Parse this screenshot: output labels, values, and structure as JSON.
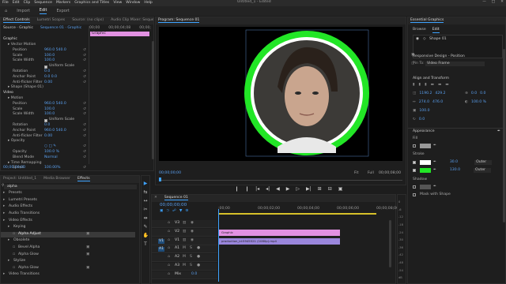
{
  "menubar": {
    "items": [
      "File",
      "Edit",
      "Clip",
      "Sequence",
      "Markers",
      "Graphics and Titles",
      "View",
      "Window",
      "Help"
    ],
    "title": "Untitled_1 - Edited",
    "controls": [
      "—",
      "□",
      "✕"
    ]
  },
  "workspaces": {
    "items": [
      "⌂",
      "Import",
      "Edit",
      "Export"
    ],
    "active": 2
  },
  "effect_controls": {
    "tabs": [
      "Effect Controls",
      "Lumetri Scopes",
      "Source: (no clips)",
      "Audio Clip Mixer: Sequence 01"
    ],
    "source": "Source · Graphic",
    "clip": "Sequence 01 · Graphic",
    "timecodes": [
      "00;00",
      "00;00;04;08",
      "00;00;"
    ],
    "clip_bar": "Graphic",
    "rows": [
      {
        "indent": 0,
        "label": "Graphic"
      },
      {
        "indent": 1,
        "label": "▸ Vector Motion"
      },
      {
        "indent": 2,
        "label": "Position",
        "value": "960.0   540.0"
      },
      {
        "indent": 2,
        "label": "Scale",
        "value": "100.0"
      },
      {
        "indent": 2,
        "label": "Scale Width",
        "value": "100.0"
      },
      {
        "indent": 2,
        "label": "",
        "check": "Uniform Scale"
      },
      {
        "indent": 2,
        "label": "Rotation",
        "value": "0.0"
      },
      {
        "indent": 2,
        "label": "Anchor Point",
        "value": "0.0   0.0"
      },
      {
        "indent": 2,
        "label": "Anti-flicker Filter",
        "value": "0.00"
      },
      {
        "indent": 1,
        "label": "▸ Shape (Shape 01)"
      },
      {
        "indent": 0,
        "label": "Video"
      },
      {
        "indent": 1,
        "label": "▸ Motion"
      },
      {
        "indent": 2,
        "label": "Position",
        "value": "960.0   540.0"
      },
      {
        "indent": 2,
        "label": "Scale",
        "value": "100.0"
      },
      {
        "indent": 2,
        "label": "Scale Width",
        "value": "100.0"
      },
      {
        "indent": 2,
        "label": "",
        "check": "Uniform Scale"
      },
      {
        "indent": 2,
        "label": "Rotation",
        "value": "0.0"
      },
      {
        "indent": 2,
        "label": "Anchor Point",
        "value": "960.0   540.0"
      },
      {
        "indent": 2,
        "label": "Anti-flicker Filter",
        "value": "0.00"
      },
      {
        "indent": 1,
        "label": "▸ Opacity"
      },
      {
        "indent": 2,
        "label": "",
        "value": "○ □ ✎"
      },
      {
        "indent": 2,
        "label": "Opacity",
        "value": "100.0 %"
      },
      {
        "indent": 2,
        "label": "Blend Mode",
        "value": "Normal"
      },
      {
        "indent": 1,
        "label": "▸ Time Remapping"
      },
      {
        "indent": 2,
        "label": "Speed",
        "value": "100.00%"
      }
    ],
    "footer_tc": "00;00;00;00"
  },
  "program": {
    "tab": "Program: Sequence 01",
    "timecode_left": "00;00;00;00",
    "timecode_right": "00;00;08;00",
    "fit": "Fit",
    "quality": "Full"
  },
  "transport": [
    "❙",
    "❙",
    "|◂",
    "◂|",
    "◀",
    "▶",
    "▷",
    "▶|",
    "⊞",
    "⊟",
    "▣"
  ],
  "project": {
    "tabs": [
      "Project: Untitled_1",
      "Media Browser",
      "Effects"
    ],
    "search": "alpha",
    "tree": [
      {
        "indent": 0,
        "label": "Presets"
      },
      {
        "indent": 0,
        "label": "Lumetri Presets"
      },
      {
        "indent": 0,
        "label": "Audio Effects"
      },
      {
        "indent": 0,
        "label": "Audio Transitions"
      },
      {
        "indent": 0,
        "label": "Video Effects"
      },
      {
        "indent": 1,
        "label": "Keying"
      },
      {
        "indent": 2,
        "label": "Alpha Adjust",
        "selected": true
      },
      {
        "indent": 1,
        "label": "Obsolete"
      },
      {
        "indent": 2,
        "label": "Bevel Alpha"
      },
      {
        "indent": 2,
        "label": "Alpha Glow"
      },
      {
        "indent": 1,
        "label": "Stylize"
      },
      {
        "indent": 2,
        "label": "Alpha Glow"
      },
      {
        "indent": 0,
        "label": "Video Transitions"
      }
    ]
  },
  "tools": [
    "▶",
    "⇆",
    "↔",
    "✂",
    "⇹",
    "✎",
    "✋",
    "T"
  ],
  "timeline": {
    "tab": "Sequence 01",
    "timecode": "00;00;00;00",
    "ruler": [
      ":00;00",
      "00;00;02;00",
      "00;00;04;00",
      "00;00;06;00",
      "00;00;08;00"
    ],
    "tracks": [
      {
        "id": "V3",
        "a": "",
        "kind": "video"
      },
      {
        "id": "V2",
        "a": "",
        "kind": "video"
      },
      {
        "id": "V1",
        "a": "V1",
        "kind": "video"
      },
      {
        "id": "A1",
        "a": "A1",
        "kind": "audio"
      },
      {
        "id": "A2",
        "a": "",
        "kind": "audio"
      },
      {
        "id": "A3",
        "a": "",
        "kind": "audio"
      },
      {
        "id": "Mix",
        "a": "",
        "kind": "mix",
        "value": "0.0"
      }
    ],
    "clips": [
      {
        "label": "Graphic",
        "track": 1
      },
      {
        "label": "production_id:5945521 (1080p).mp4",
        "track": 2
      }
    ],
    "meter": [
      "0",
      "-6",
      "-12",
      "-18",
      "-24",
      "-30",
      "-36",
      "-42",
      "-48",
      "-54",
      "dB"
    ]
  },
  "essential_graphics": {
    "title": "Essential Graphics",
    "tabs": [
      "Browse",
      "Edit"
    ],
    "layer": "Shape 01",
    "responsive_label": "Responsive Design - Position",
    "pin_to": "Pin To:",
    "pin_value": "Video Frame",
    "align_label": "Align and Transform",
    "position": [
      "1190.2",
      "429.2"
    ],
    "rotation": "0.0",
    "anchor": [
      "0.0",
      "0.0"
    ],
    "size_pct": "100.0",
    "opacity": "100.0 %",
    "scale": [
      "274.0",
      "476.0"
    ],
    "appearance_label": "Appearance",
    "fill_label": "Fill",
    "stroke_label": "Stroke",
    "strokes": [
      {
        "value": "30.0",
        "mode": "Outer"
      },
      {
        "value": "130.0",
        "mode": "Outer"
      }
    ],
    "shadow_label": "Shadow",
    "mask_label": "Mask with Shape",
    "colors": {
      "accent": "#3ea3ff",
      "stroke_green": "#22e626",
      "fill_gray": "#9a9a9a",
      "clip_pink": "#e291e2",
      "clip_violet": "#9a86dc",
      "playhead": "#3ea3ff"
    }
  }
}
